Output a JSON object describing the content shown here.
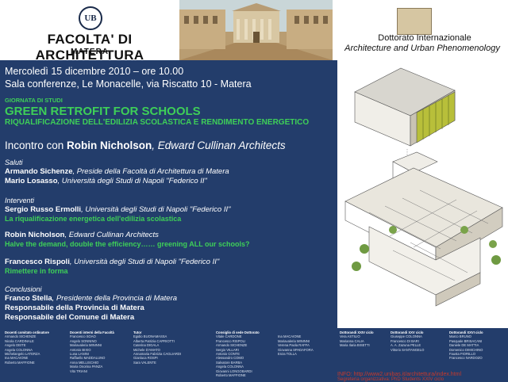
{
  "header": {
    "seal_text": "UB",
    "faculty_title": "FACOLTA' DI ARCHITETTURA",
    "faculty_city": "MATERA",
    "doctorate_line1": "Dottorato Internazionale",
    "doctorate_line2": "Architecture and Urban Phenomenology"
  },
  "event": {
    "date_line": "Mercoledì 15 dicembre 2010 – ore 10.00",
    "venue_line": "Sala conferenze, Le Monacelle, via Riscatto 10 - Matera",
    "kicker": "GIORNATA DI STUDI",
    "title": "GREEN RETROFIT FOR SCHOOLS",
    "subtitle": "RIQUALIFICAZIONE DELL'EDILIZIA SCOLASTICA E RENDIMENTO ENERGETICO",
    "meeting_prefix": "Incontro con ",
    "meeting_name": "Robin Nicholson",
    "meeting_firm": ", Edward Cullinan Architects"
  },
  "program": {
    "saluti_label": "Saluti",
    "saluti": [
      {
        "name": "Armando Sichenze",
        "role": ", Preside della Facoltà di Architettura di Matera"
      },
      {
        "name": "Mario Losasso",
        "role": ", Università degli Studi di Napoli \"Federico II\""
      }
    ],
    "interventi_label": "Interventi",
    "speaker1_name": "Sergio Russo Ermolli",
    "speaker1_role": ", Università degli Studi di Napoli \"Federico II\"",
    "speaker1_topic": "La riqualificazione energetica dell'edilizia scolastica",
    "speaker2_name": "Robin Nicholson",
    "speaker2_role": ", Edward Cullinan Architects",
    "speaker2_topic": "Halve the demand, double the efficiency…… greening ALL our schools?",
    "speaker3_name": "Francesco Rispoli",
    "speaker3_role": ", Università degli Studi di Napoli \"Federico II\"",
    "speaker3_topic": "Rimettere in forma",
    "conclusioni_label": "Conclusioni",
    "concl1_name": "Franco Stella",
    "concl1_role": ", Presidente della Provincia di Matera",
    "concl2": "Responsabile della Provincia di Matera",
    "concl3": "Responsabile del Comune di Matera"
  },
  "footer": {
    "columns": [
      {
        "heading": "Docenti comitato ordinatore",
        "names": [
          "Armando SICHENZE",
          "Nicola CARDINALE",
          "Angelo DEITE",
          "Angela COLONNA",
          "Michelangelo LATERZA",
          "Ina MACAIONE",
          "Roberto MAFFIONE"
        ]
      },
      {
        "heading": "Docenti interni della Facoltà",
        "names": [
          "Francesco SOAO",
          "Angelo SONNINO",
          "Mariavaleria MININNI",
          "Antonio BIXIO",
          "Luna LANINI",
          "Raffaello MADDALUNO",
          "Anna MELLISCHIO",
          "Maria Onorina PANZA",
          "Vito TRIANI"
        ]
      },
      {
        "heading": "Tutor",
        "names": [
          "Egidio BUONAMASSA",
          "Alberta Patrizia CAPRIOTTI",
          "Caterina DIGALA",
          "Michele D'AMATO",
          "Annamaria Fabrizia CAGLIARDI",
          "Gianluca ROSPI",
          "Sara VALENTE"
        ]
      },
      {
        "heading": "Consiglio di sede Dottorato",
        "names": [
          "Vitale CARDONE",
          "Francesco RISPOLI",
          "Armando SICHENZE",
          "Sergio VILLARI",
          "Antonio CONTE",
          "Alessandro COMO",
          "Salvatore BARBA",
          "Angela COLONNA",
          "Giovanni LONGOBARDI",
          "Roberto MAFFIONE"
        ]
      },
      {
        "heading": "",
        "names": [
          "Ina MACAIONE",
          "Mariavaleria MININNI",
          "Verena Paola RAFFA",
          "Giovanna SPADAFORA",
          "Enza TOLLA"
        ]
      },
      {
        "heading": "Dottorandi XXIV ciclo",
        "names": [
          "Vera ASTILIO",
          "Marianna CALIA",
          "Maria Ilaria BISETTI"
        ]
      },
      {
        "heading": "Dottorandi XXV ciclo",
        "names": [
          "Giuseppe COLONNA",
          "Francesco DI BARI",
          "A. A. Zazuna PELLE",
          "Vittorio SANTANGELO"
        ]
      },
      {
        "heading": "Dottorandi XXVI ciclo",
        "names": [
          "Marco BRUNO",
          "Pasquale BRISACANI",
          "Daniele DE MATTIA",
          "Domenico DIMICHINO",
          "Fausta FIORILLO",
          "Francesco NARDOZO"
        ]
      }
    ],
    "info1": "INFO: http://www2.unibas.it/architettura/index.html",
    "info2": "Segreteria organizzativa: PhD Students XXIV ciclo"
  },
  "colors": {
    "panel_blue": "#233d6b",
    "accent_green": "#3ecf58",
    "info_red": "#c8392b"
  }
}
